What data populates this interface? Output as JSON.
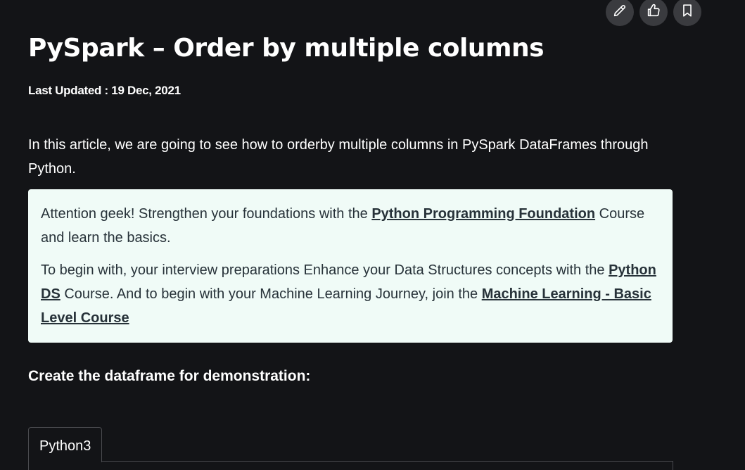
{
  "toolbar": {
    "buttons": [
      {
        "icon": "pencil-icon",
        "name": "edit-button"
      },
      {
        "icon": "thumbs-up-icon",
        "name": "like-button"
      },
      {
        "icon": "bookmark-icon",
        "name": "bookmark-button"
      }
    ]
  },
  "article": {
    "title": "PySpark – Order by multiple columns",
    "last_updated": "Last Updated : 19 Dec, 2021",
    "intro": "In this article, we are going to see how to orderby multiple columns in  PySpark DataFrames through Python."
  },
  "callout": {
    "p1_prefix": " Attention geek! Strengthen your foundations with the ",
    "p1_link": "Python Programming Foundation",
    "p1_suffix": " Course and learn the basics.",
    "p2_prefix": "To begin with, your interview preparations Enhance your Data Structures concepts with the ",
    "p2_link1": "Python DS",
    "p2_middle": " Course. And to begin with your Machine Learning Journey, join the ",
    "p2_link2": "Machine Learning - Basic Level Course",
    "p2_suffix": ""
  },
  "section": {
    "heading": "Create the dataframe for demonstration:"
  },
  "code": {
    "tab_label": "Python3"
  },
  "colors": {
    "background": "#131417",
    "callout_bg": "#f0fbf7",
    "callout_text": "#273239",
    "button_bg": "#3a3b3f"
  }
}
